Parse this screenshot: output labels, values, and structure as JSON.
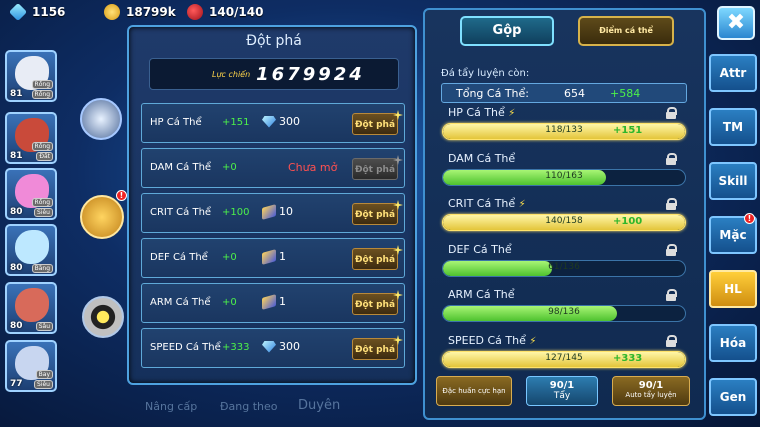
{
  "resources": {
    "gems": "1156",
    "coins": "18799k",
    "stamina": "140/140"
  },
  "team": [
    {
      "level": "81",
      "tags": [
        "Rồng",
        "Rồng"
      ],
      "color": "#e8ecf5"
    },
    {
      "level": "81",
      "tags": [
        "Rồng",
        "Đất"
      ],
      "color": "#c94a3a"
    },
    {
      "level": "80",
      "tags": [
        "Rồng",
        "Siêu"
      ],
      "color": "#f08ad8"
    },
    {
      "level": "80",
      "tags": [
        "",
        "Băng"
      ],
      "color": "#bde8ff"
    },
    {
      "level": "80",
      "tags": [
        "",
        "Sâu"
      ],
      "color": "#d86a5a"
    },
    {
      "level": "77",
      "tags": [
        "Bay",
        "Siêu"
      ],
      "color": "#c8d6f0"
    }
  ],
  "behind_panel": {
    "upgrade": "Nâng cấp",
    "following": "Đang theo",
    "fate": "Duyên"
  },
  "breakthrough": {
    "title": "Đột phá",
    "power_label": "Lực chiến",
    "power_value": "1679924",
    "rows": [
      {
        "name": "HP Cá Thể",
        "plus": "+151",
        "cost_icon": "gem-icon",
        "cost": "300",
        "button": "Đột phá",
        "locked_text": "",
        "enabled": true
      },
      {
        "name": "DAM Cá Thể",
        "plus": "+0",
        "cost_icon": "",
        "cost": "",
        "button": "Đột phá",
        "locked_text": "Chưa mở",
        "enabled": false
      },
      {
        "name": "CRIT Cá Thể",
        "plus": "+100",
        "cost_icon": "scroll-icon",
        "cost": "10",
        "button": "Đột phá",
        "locked_text": "",
        "enabled": true
      },
      {
        "name": "DEF Cá Thể",
        "plus": "+0",
        "cost_icon": "scroll-icon",
        "cost": "1",
        "button": "Đột phá",
        "locked_text": "",
        "enabled": true
      },
      {
        "name": "ARM Cá Thể",
        "plus": "+0",
        "cost_icon": "scroll-icon",
        "cost": "1",
        "button": "Đột phá",
        "locked_text": "",
        "enabled": true
      },
      {
        "name": "SPEED Cá Thể",
        "plus": "+333",
        "cost_icon": "gem-icon",
        "cost": "300",
        "button": "Đột phá",
        "locked_text": "",
        "enabled": true
      }
    ]
  },
  "training": {
    "tab_merge": "Gộp",
    "tab_points": "Điểm cá thể",
    "remaining_label": "Đá tẩy luyện còn:",
    "total_label": "Tổng Cá Thể:",
    "total_value": "654",
    "total_bonus": "+584",
    "stats": [
      {
        "name": "HP Cá Thể",
        "value": "118/133",
        "fraction": 0.887,
        "bonus": "+151",
        "highlight": true
      },
      {
        "name": "DAM Cá Thể",
        "value": "110/163",
        "fraction": 0.675,
        "bonus": "",
        "highlight": false
      },
      {
        "name": "CRIT Cá Thể",
        "value": "140/158",
        "fraction": 0.886,
        "bonus": "+100",
        "highlight": true
      },
      {
        "name": "DEF Cá Thể",
        "value": "61/136",
        "fraction": 0.449,
        "bonus": "",
        "highlight": false
      },
      {
        "name": "ARM Cá Thể",
        "value": "98/136",
        "fraction": 0.721,
        "bonus": "",
        "highlight": false
      },
      {
        "name": "SPEED Cá Thể",
        "value": "127/145",
        "fraction": 0.876,
        "bonus": "+333",
        "highlight": true
      }
    ],
    "btn_special": "Đặc huấn cực hạn",
    "btn_wash_count": "90/1",
    "btn_wash_label": "Tẩy",
    "btn_auto_count": "90/1",
    "btn_auto_label": "Auto tẩy luyện"
  },
  "nav": [
    "Attr",
    "TM",
    "Skill",
    "Mặc",
    "HL",
    "Hóa",
    "Gen"
  ],
  "nav_active": "HL",
  "close_label": "✖"
}
